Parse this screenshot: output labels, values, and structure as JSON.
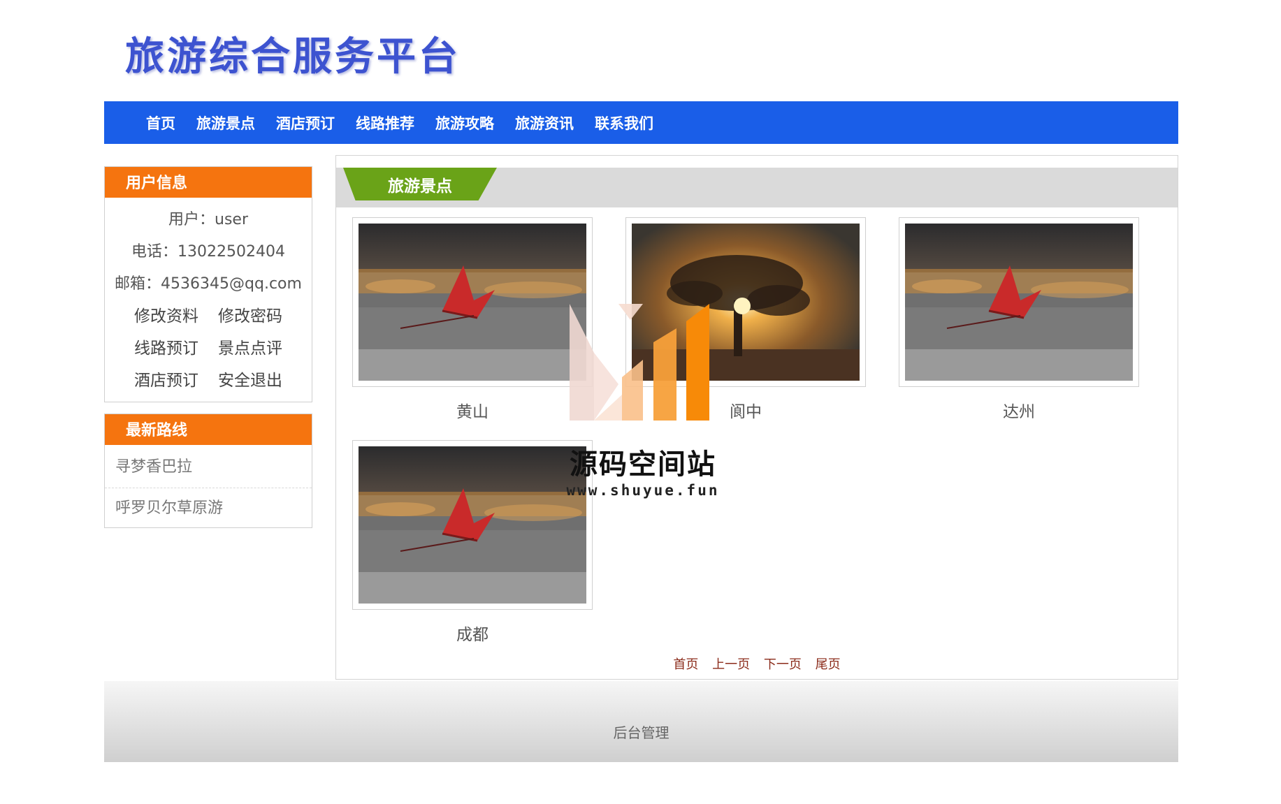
{
  "header": {
    "title": "旅游综合服务平台"
  },
  "nav": {
    "items": [
      "首页",
      "旅游景点",
      "酒店预订",
      "线路推荐",
      "旅游攻略",
      "旅游资讯",
      "联系我们"
    ]
  },
  "user_info": {
    "heading": "用户信息",
    "user": "用户：user",
    "phone": "电话：13022502404",
    "email": "邮箱：4536345@qq.com",
    "links": [
      "修改资料",
      "修改密码",
      "线路预订",
      "景点点评",
      "酒店预订",
      "安全退出"
    ]
  },
  "latest_routes": {
    "heading": "最新路线",
    "items": [
      "寻梦香巴拉",
      "呼罗贝尔草原游"
    ]
  },
  "main": {
    "heading": "旅游景点",
    "cards": [
      {
        "label": "黄山",
        "image": "autumn-leaf-photo"
      },
      {
        "label": "阆中",
        "image": "sunset-tree-photo"
      },
      {
        "label": "达州",
        "image": "autumn-leaf-photo"
      },
      {
        "label": "成都",
        "image": "autumn-leaf-photo"
      }
    ]
  },
  "pager": {
    "first": "首页",
    "prev": "上一页",
    "next": "下一页",
    "last": "尾页"
  },
  "footer": {
    "admin": "后台管理"
  },
  "watermark": {
    "text": "源码空间站",
    "url": "www.shuyue.fun"
  },
  "colors": {
    "nav": "#1a5ee8",
    "side_head": "#f5740f",
    "tab": "#6aa318",
    "title": "#3d53d0"
  }
}
